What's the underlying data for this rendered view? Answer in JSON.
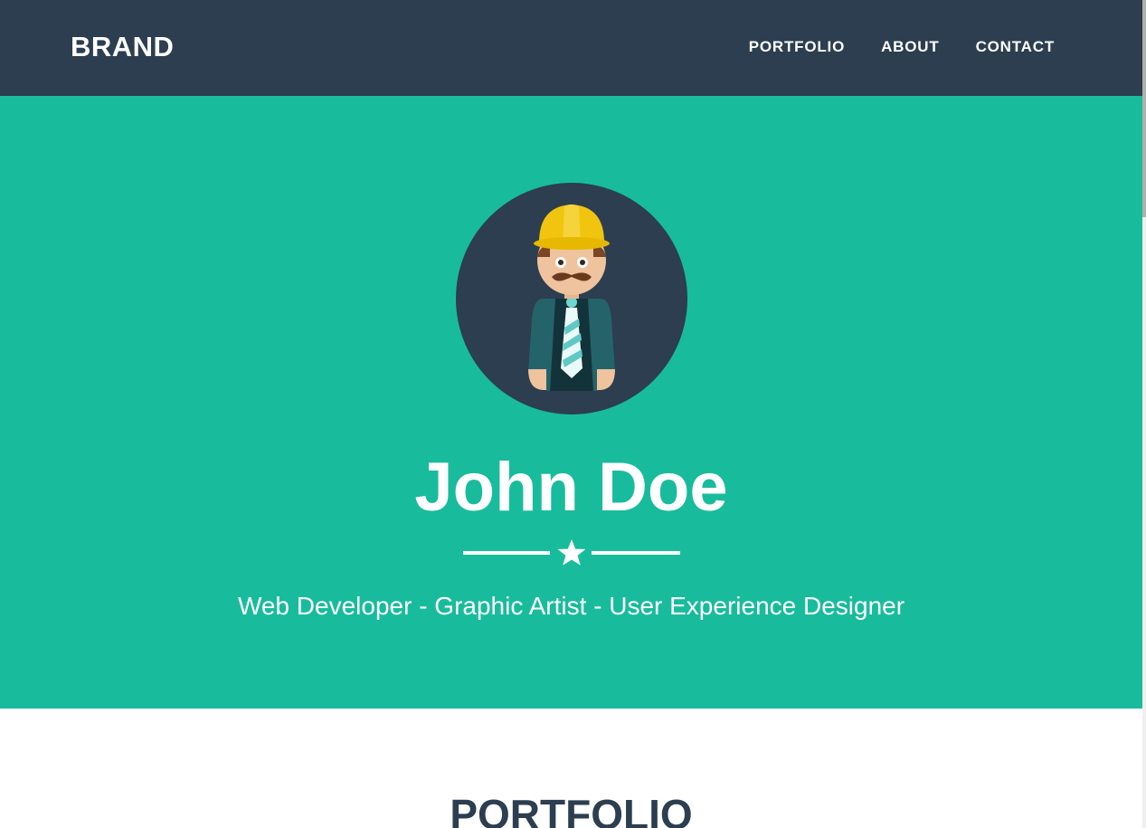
{
  "navbar": {
    "brand": "BRAND",
    "links": [
      "PORTFOLIO",
      "ABOUT",
      "CONTACT"
    ]
  },
  "hero": {
    "name": "John Doe",
    "tagline": "Web Developer - Graphic Artist - User Experience Designer",
    "avatar_icon": "developer-avatar-icon",
    "divider_icon": "star-icon"
  },
  "portfolio": {
    "title": "PORTFOLIO"
  },
  "colors": {
    "navbar": "#2c3e50",
    "hero": "#18bc9c",
    "text_dark": "#2c3e50",
    "text_light": "#ffffff"
  }
}
